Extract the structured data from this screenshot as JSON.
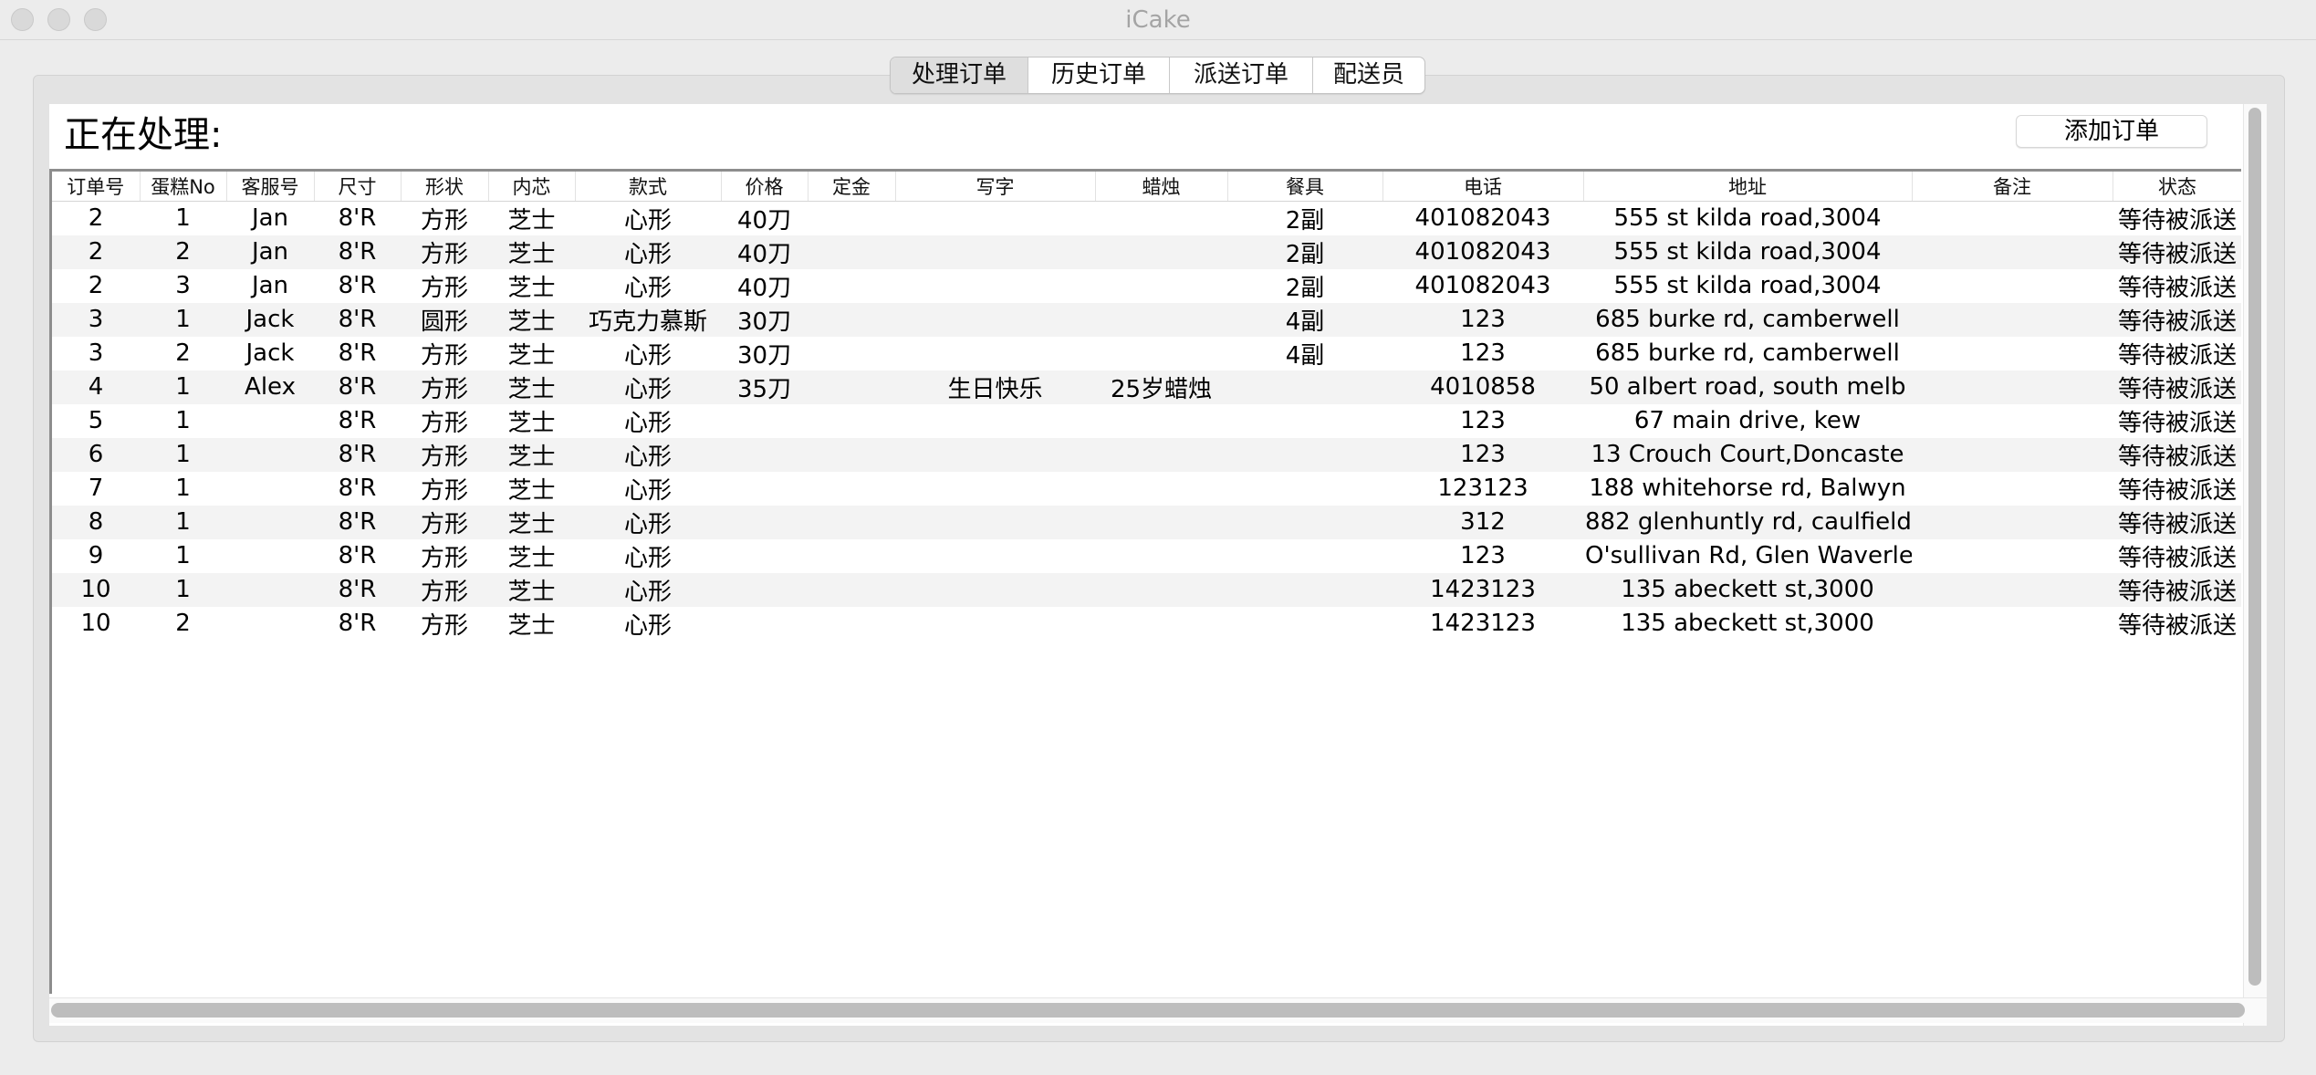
{
  "window": {
    "title": "iCake"
  },
  "tabs": [
    "处理订单",
    "历史订单",
    "派送订单",
    "配送员"
  ],
  "active_tab": 0,
  "section": {
    "title": "正在处理:",
    "add_button": "添加订单"
  },
  "table": {
    "columns": [
      "订单号",
      "蛋糕No",
      "客服号",
      "尺寸",
      "形状",
      "内芯",
      "款式",
      "价格",
      "定金",
      "写字",
      "蜡烛",
      "餐具",
      "电话",
      "地址",
      "备注",
      "状态"
    ],
    "rows": [
      [
        "2",
        "1",
        "Jan",
        "8'R",
        "方形",
        "芝士",
        "心形",
        "40刀",
        "",
        "",
        "",
        "2副",
        "401082043",
        "555 st kilda road,3004",
        "",
        "等待被派送"
      ],
      [
        "2",
        "2",
        "Jan",
        "8'R",
        "方形",
        "芝士",
        "心形",
        "40刀",
        "",
        "",
        "",
        "2副",
        "401082043",
        "555 st kilda road,3004",
        "",
        "等待被派送"
      ],
      [
        "2",
        "3",
        "Jan",
        "8'R",
        "方形",
        "芝士",
        "心形",
        "40刀",
        "",
        "",
        "",
        "2副",
        "401082043",
        "555 st kilda road,3004",
        "",
        "等待被派送"
      ],
      [
        "3",
        "1",
        "Jack",
        "8'R",
        "圆形",
        "芝士",
        "巧克力慕斯",
        "30刀",
        "",
        "",
        "",
        "4副",
        "123",
        "685 burke rd, camberwell",
        "",
        "等待被派送"
      ],
      [
        "3",
        "2",
        "Jack",
        "8'R",
        "方形",
        "芝士",
        "心形",
        "30刀",
        "",
        "",
        "",
        "4副",
        "123",
        "685 burke rd, camberwell",
        "",
        "等待被派送"
      ],
      [
        "4",
        "1",
        "Alex",
        "8'R",
        "方形",
        "芝士",
        "心形",
        "35刀",
        "",
        "生日快乐",
        "25岁蜡烛",
        "",
        "4010858",
        "50 albert road, south melb",
        "",
        "等待被派送"
      ],
      [
        "5",
        "1",
        "",
        "8'R",
        "方形",
        "芝士",
        "心形",
        "",
        "",
        "",
        "",
        "",
        "123",
        "67 main drive, kew",
        "",
        "等待被派送"
      ],
      [
        "6",
        "1",
        "",
        "8'R",
        "方形",
        "芝士",
        "心形",
        "",
        "",
        "",
        "",
        "",
        "123",
        "13 Crouch Court,Doncaste",
        "",
        "等待被派送"
      ],
      [
        "7",
        "1",
        "",
        "8'R",
        "方形",
        "芝士",
        "心形",
        "",
        "",
        "",
        "",
        "",
        "123123",
        "188 whitehorse rd, Balwyn",
        "",
        "等待被派送"
      ],
      [
        "8",
        "1",
        "",
        "8'R",
        "方形",
        "芝士",
        "心形",
        "",
        "",
        "",
        "",
        "",
        "312",
        "882 glenhuntly rd, caulfield",
        "",
        "等待被派送"
      ],
      [
        "9",
        "1",
        "",
        "8'R",
        "方形",
        "芝士",
        "心形",
        "",
        "",
        "",
        "",
        "",
        "123",
        "O'sullivan Rd, Glen Waverley",
        "",
        "等待被派送"
      ],
      [
        "10",
        "1",
        "",
        "8'R",
        "方形",
        "芝士",
        "心形",
        "",
        "",
        "",
        "",
        "",
        "1423123",
        "135 abeckett st,3000",
        "",
        "等待被派送"
      ],
      [
        "10",
        "2",
        "",
        "8'R",
        "方形",
        "芝士",
        "心形",
        "",
        "",
        "",
        "",
        "",
        "1423123",
        "135 abeckett st,3000",
        "",
        "等待被派送"
      ]
    ]
  }
}
